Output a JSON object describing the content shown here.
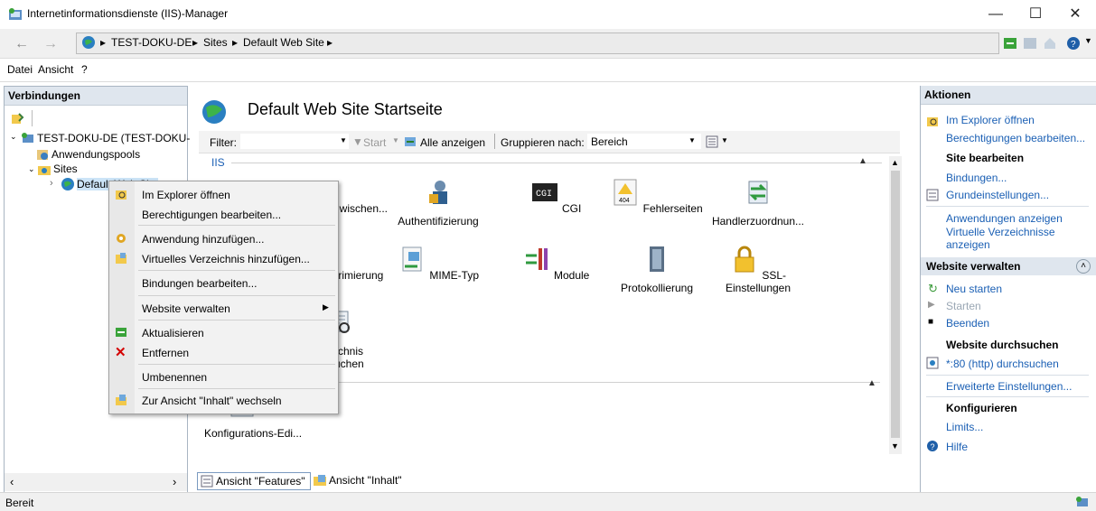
{
  "window": {
    "title": "Internetinformationsdienste (IIS)-Manager"
  },
  "breadcrumb": [
    "TEST-DOKU-DE",
    "Sites",
    "Default Web Site"
  ],
  "menu": [
    "Datei",
    "Ansicht",
    "?"
  ],
  "connections": {
    "title": "Verbindungen",
    "server": "TEST-DOKU-DE (TEST-DOKU-",
    "apppools": "Anwendungspools",
    "sites": "Sites",
    "site": "Default Web Site"
  },
  "center": {
    "title": "Default Web Site Startseite",
    "filter_label": "Filter:",
    "start_label": "Start",
    "show_all": "Alle anzeigen",
    "group_label": "Gruppieren nach:",
    "group_value": "Bereich",
    "section_iis": "IIS",
    "features_row1": [
      "bezwischen...",
      "Authentifizierung",
      "CGI",
      "Fehlerseiten",
      "Handlerzuordnun..."
    ],
    "features_row2": [
      "nprimierung",
      "MIME-Typ",
      "Module",
      "Protokollierung",
      "SSL-Einstellungen"
    ],
    "feature_row3": [
      "erzeichnis",
      "rchsuchen"
    ],
    "feature_config": "Konfigurations-Edi...",
    "tab_features": "Ansicht \"Features\"",
    "tab_content": "Ansicht \"Inhalt\""
  },
  "context_menu": {
    "items": [
      "Im Explorer öffnen",
      "Berechtigungen bearbeiten...",
      "Anwendung hinzufügen...",
      "Virtuelles Verzeichnis hinzufügen...",
      "Bindungen bearbeiten...",
      "Website verwalten",
      "Aktualisieren",
      "Entfernen",
      "Umbenennen",
      "Zur Ansicht \"Inhalt\" wechseln"
    ]
  },
  "actions": {
    "title": "Aktionen",
    "explorer": "Im Explorer öffnen",
    "permissions": "Berechtigungen bearbeiten...",
    "site_edit": "Site bearbeiten",
    "bindings": "Bindungen...",
    "basic": "Grundeinstellungen...",
    "show_apps": "Anwendungen anzeigen",
    "show_vdirs": "Virtuelle Verzeichnisse anzeigen",
    "manage": "Website verwalten",
    "restart": "Neu starten",
    "start": "Starten",
    "stop": "Beenden",
    "browse_head": "Website durchsuchen",
    "browse": "*:80 (http) durchsuchen",
    "advanced": "Erweiterte Einstellungen...",
    "configure": "Konfigurieren",
    "limits": "Limits...",
    "help": "Hilfe"
  },
  "status": {
    "text": "Bereit"
  }
}
